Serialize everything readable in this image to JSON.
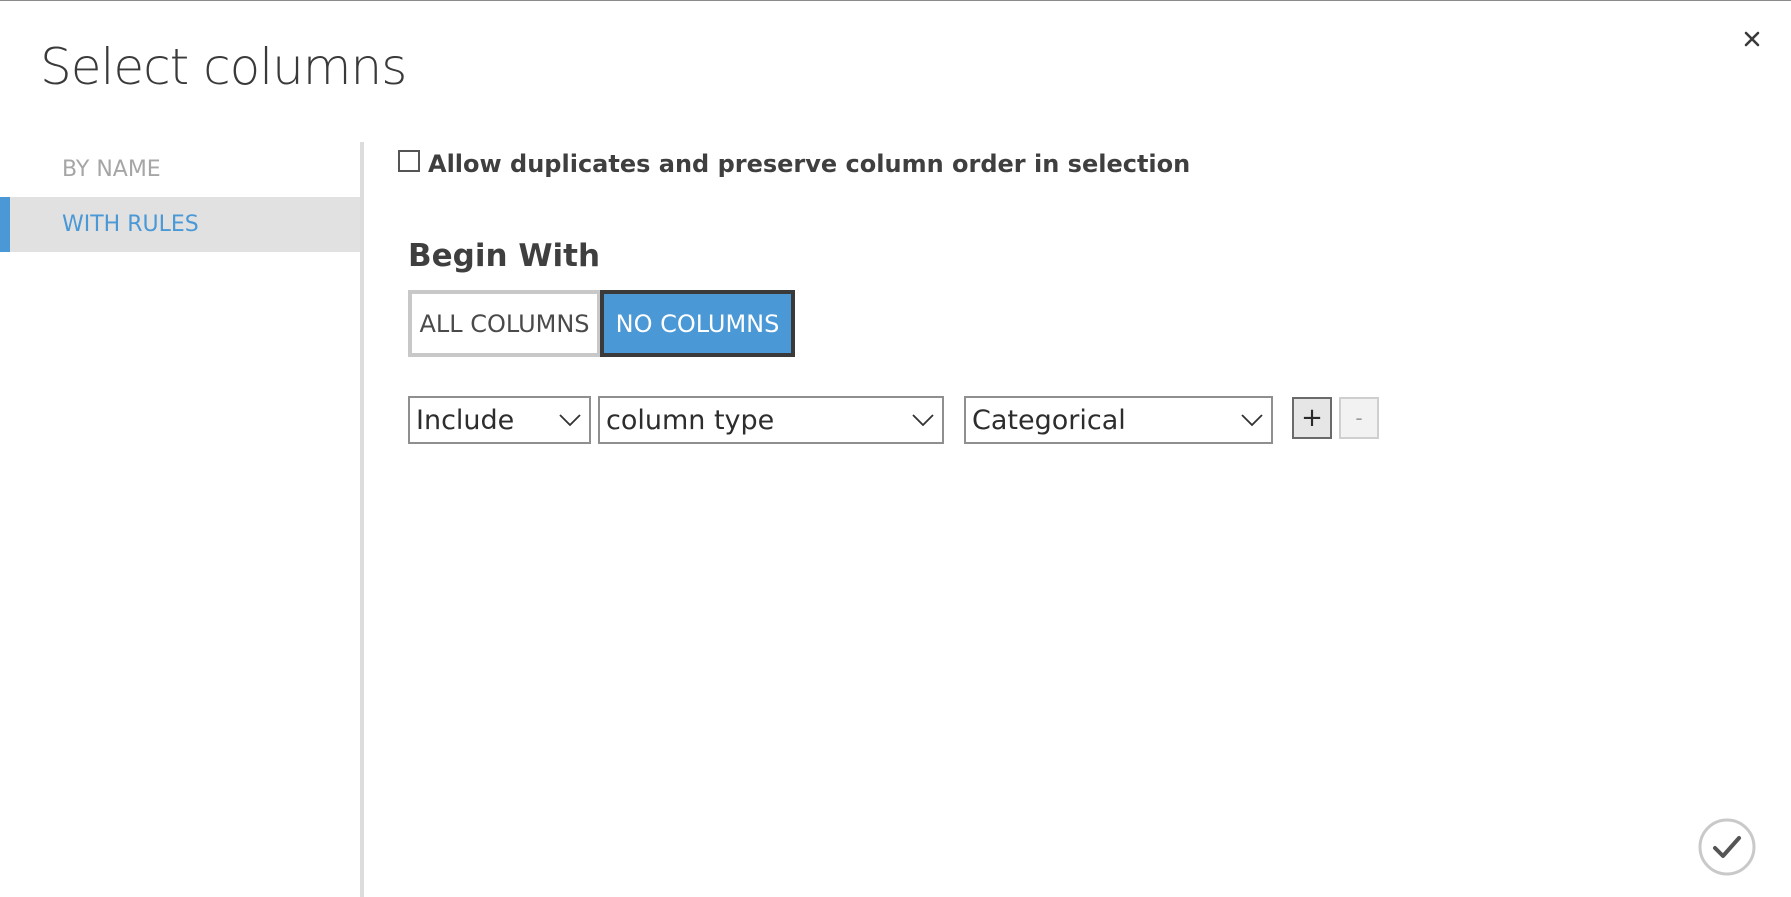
{
  "dialog": {
    "title": "Select columns"
  },
  "nav": {
    "items": [
      {
        "label": "BY NAME",
        "active": false
      },
      {
        "label": "WITH RULES",
        "active": true
      }
    ]
  },
  "options": {
    "allow_duplicates_label": "Allow duplicates and preserve column order in selection",
    "allow_duplicates_checked": false
  },
  "begin_with": {
    "title": "Begin With",
    "all_columns_label": "ALL COLUMNS",
    "no_columns_label": "NO COLUMNS",
    "selected": "NO COLUMNS"
  },
  "rule": {
    "action_value": "Include",
    "criterion_value": "column type",
    "type_value": "Categorical",
    "add_label": "+",
    "remove_label": "-"
  },
  "colors": {
    "accent": "#4a98d6",
    "nav_active_bg": "#e1e1e1",
    "text_dark": "#3f3f3f",
    "text_muted": "#a6a6a6"
  },
  "icons": {
    "close": "close-icon",
    "chevron": "chevron-down-icon",
    "confirm": "checkmark-icon"
  }
}
